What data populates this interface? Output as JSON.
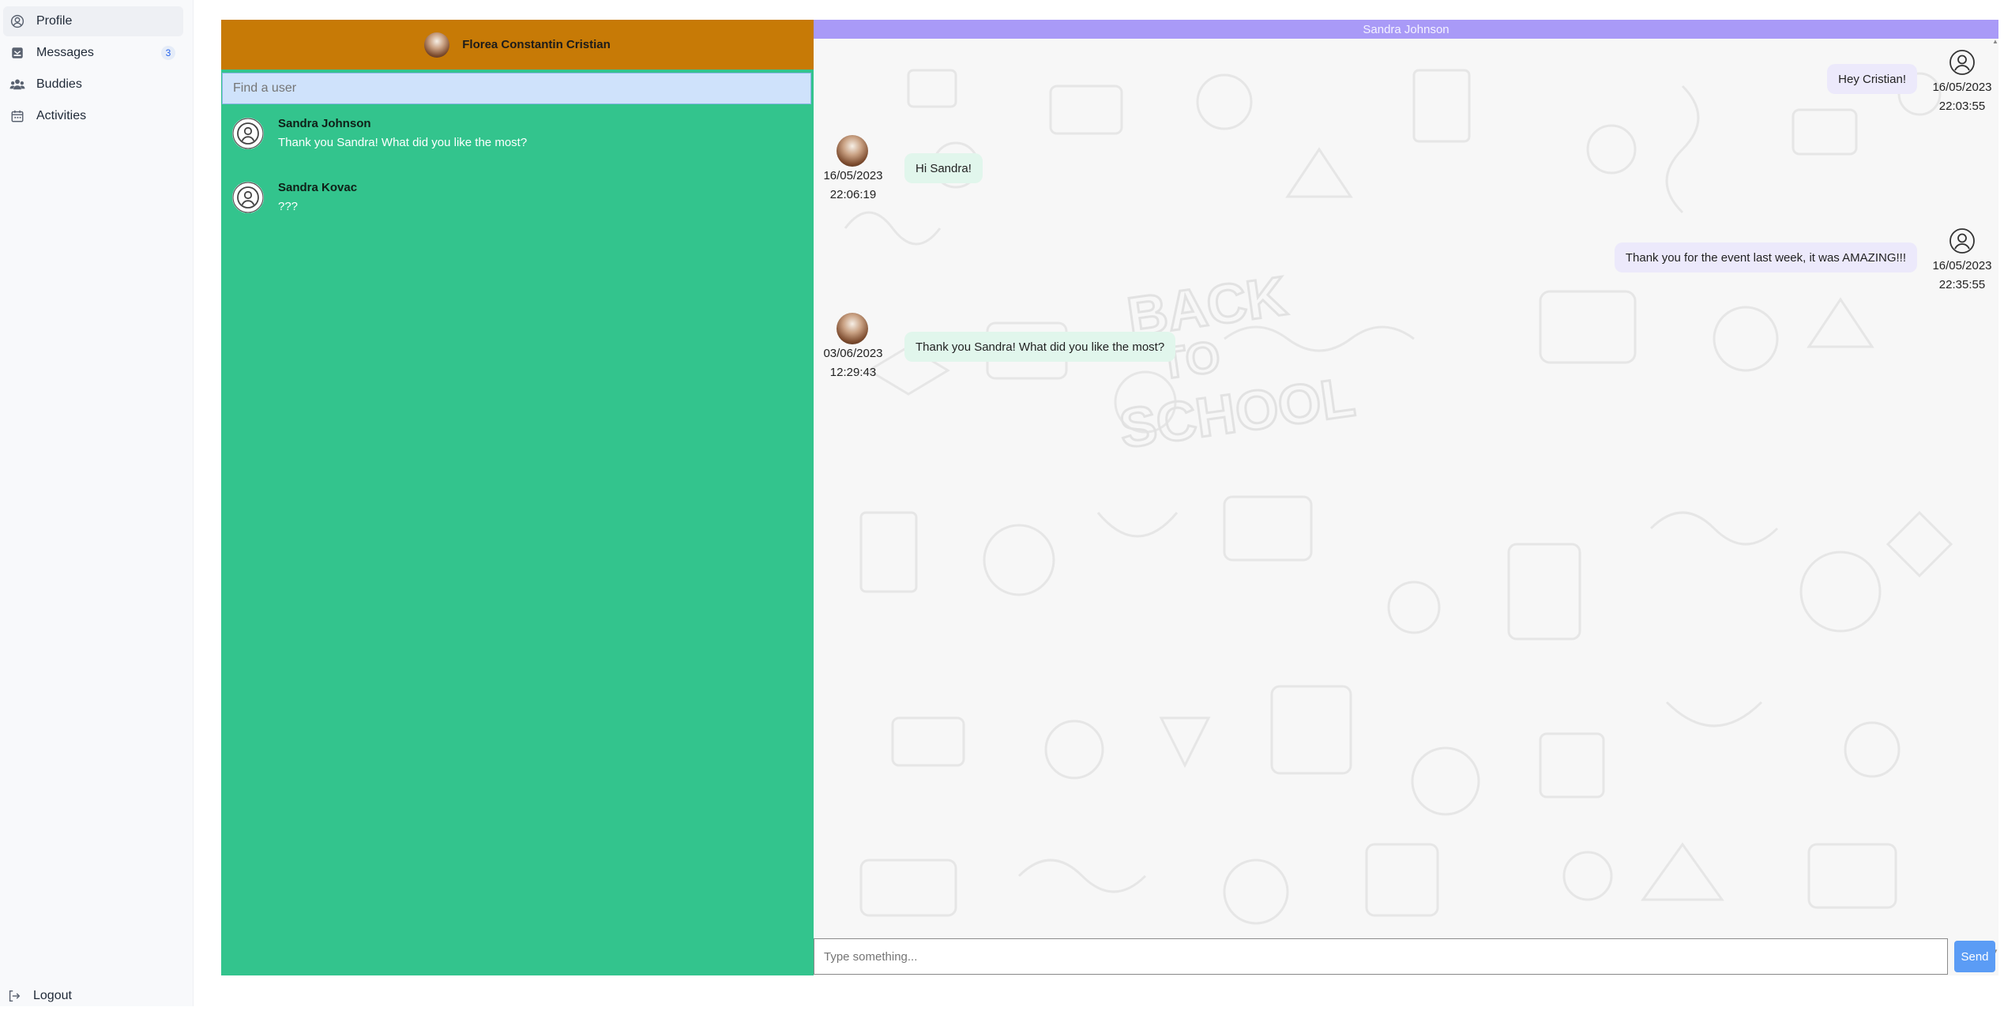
{
  "sidebar": {
    "items": [
      {
        "label": "Profile",
        "icon": "user-circle-icon"
      },
      {
        "label": "Messages",
        "icon": "inbox-icon",
        "badge": "3"
      },
      {
        "label": "Buddies",
        "icon": "users-icon"
      },
      {
        "label": "Activities",
        "icon": "calendar-icon"
      }
    ],
    "logout": {
      "label": "Logout",
      "icon": "logout-icon"
    }
  },
  "conversations": {
    "current_user": "Florea Constantin Cristian",
    "search_placeholder": "Find a user",
    "items": [
      {
        "name": "Sandra Johnson",
        "preview": "Thank you Sandra! What did you like the most?"
      },
      {
        "name": "Sandra Kovac",
        "preview": "???"
      }
    ]
  },
  "chat": {
    "title": "Sandra Johnson",
    "messages": [
      {
        "direction": "out",
        "text": "Hey Cristian!",
        "date": "16/05/2023",
        "time": "22:03:55"
      },
      {
        "direction": "in",
        "text": "Hi Sandra!",
        "date": "16/05/2023",
        "time": "22:06:19"
      },
      {
        "direction": "out",
        "text": "Thank you for the event last week, it was AMAZING!!!",
        "date": "16/05/2023",
        "time": "22:35:55"
      },
      {
        "direction": "in",
        "text": "Thank you Sandra! What did you like the most?",
        "date": "03/06/2023",
        "time": "12:29:43"
      }
    ],
    "input_placeholder": "Type something...",
    "send_label": "Send",
    "background_text": "BACK TO SCHOOL"
  },
  "colors": {
    "left_panel_bg": "#33c48d",
    "user_header_bg": "#c77a06",
    "chat_title_bg": "#a99af7",
    "send_button_bg": "#5b9cf5",
    "bubble_incoming": "#e1f6ec",
    "bubble_outgoing": "#ece9fb"
  }
}
